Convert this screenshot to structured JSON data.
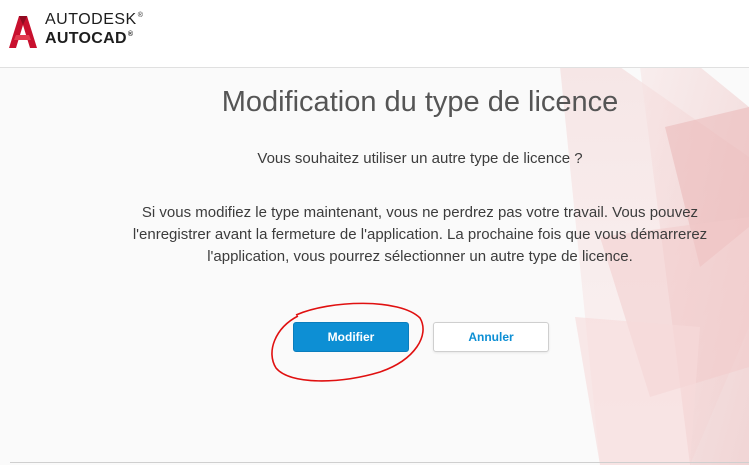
{
  "brand": {
    "line1": "AUTODESK",
    "line2": "AUTOCAD",
    "trademark": "®",
    "logo_color": "#c8102e"
  },
  "dialog": {
    "title": "Modification du type de licence",
    "subtitle": "Vous souhaitez utiliser un autre type de licence ?",
    "body_lines": [
      "Si vous modifiez le type maintenant, vous ne perdrez pas votre travail. Vous pouvez",
      "l'enregistrer avant la fermeture de l'application. La prochaine fois que vous démarrerez",
      "l'application, vous pourrez sélectionner un autre type de licence."
    ]
  },
  "buttons": {
    "primary_label": "Modifier",
    "secondary_label": "Annuler"
  },
  "colors": {
    "accent": "#0d8fd4",
    "annotation": "#e01010"
  }
}
